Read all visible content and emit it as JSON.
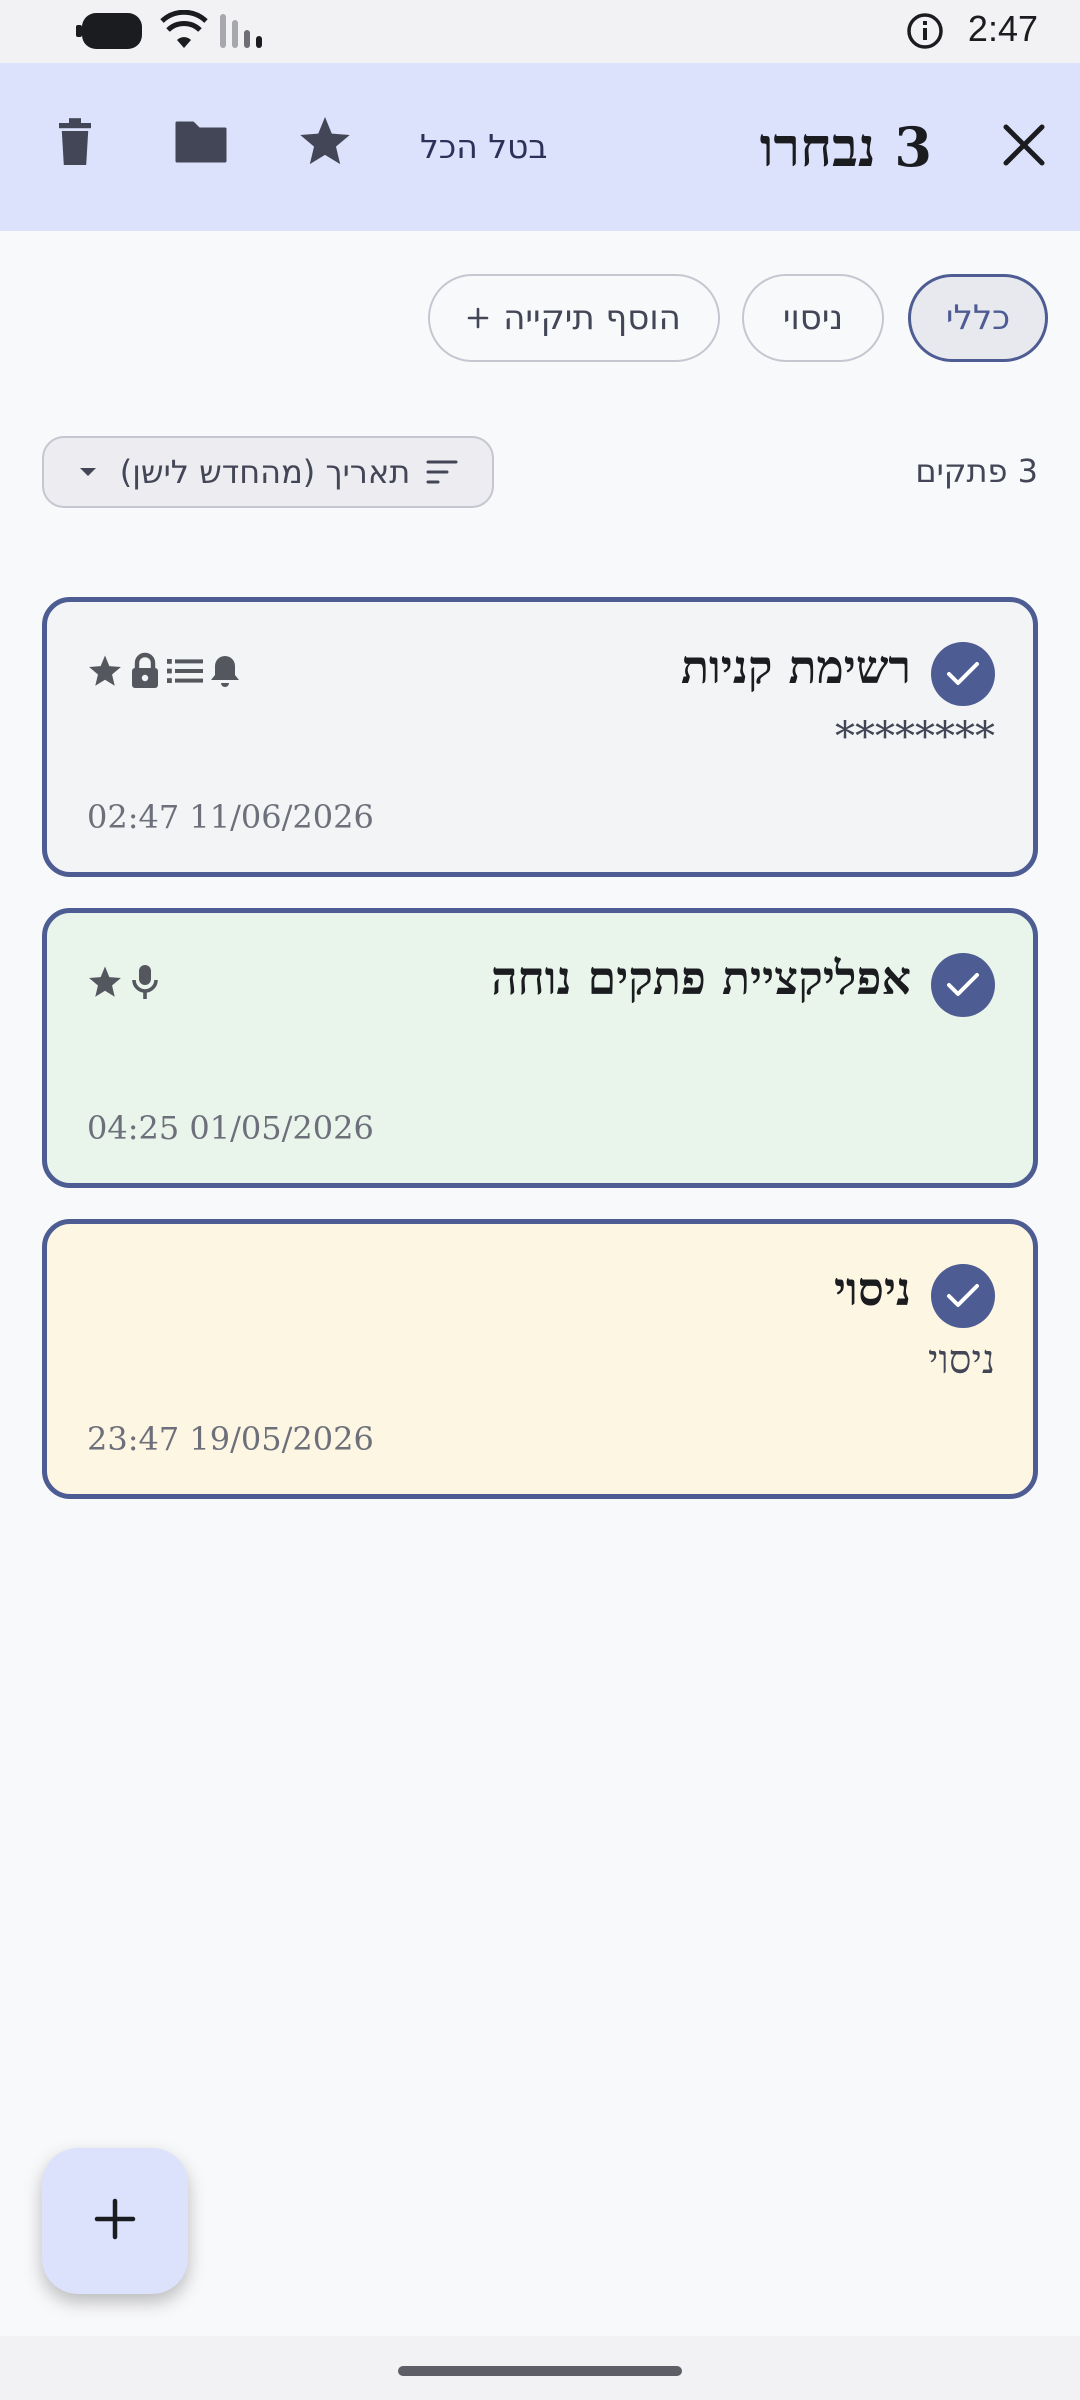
{
  "status_bar": {
    "time": "2:47",
    "icons": [
      "battery-icon",
      "wifi-icon",
      "signal-icon",
      "info-icon"
    ]
  },
  "selection_bar": {
    "title": "3 נבחרו",
    "deselect_all_label": "בטל הכל",
    "icons": [
      "close-icon",
      "star-icon",
      "folder-icon",
      "trash-icon"
    ]
  },
  "folders": {
    "chips": [
      {
        "label": "כללי",
        "selected": true
      },
      {
        "label": "ניסוי",
        "selected": false
      }
    ],
    "add_folder_label": "הוסף תיקייה"
  },
  "list_header": {
    "count_text": "3 פתקים",
    "sort_label": "תאריך (מהחדש לישן)"
  },
  "notes": [
    {
      "title": "רשימת קניות",
      "body": "********",
      "date": "02:47 11/06/2026",
      "background": "#f3f4f6",
      "selected": true,
      "icons": [
        "star-icon",
        "lock-icon",
        "list-icon",
        "bell-icon"
      ]
    },
    {
      "title": "אפליקציית פתקים נוחה",
      "body": "",
      "date": "04:25 01/05/2026",
      "background": "#e9f4eb",
      "selected": true,
      "icons": [
        "star-icon",
        "microphone-icon"
      ]
    },
    {
      "title": "ניסוי",
      "body": "ניסוי",
      "date": "23:47 19/05/2026",
      "background": "#fdf6e3",
      "selected": true,
      "icons": []
    }
  ],
  "fab": {
    "icon": "plus-icon"
  },
  "colors": {
    "accent": "#4d5c92",
    "appbar_bg": "#dce1fc",
    "page_bg": "#f8f9fb"
  }
}
